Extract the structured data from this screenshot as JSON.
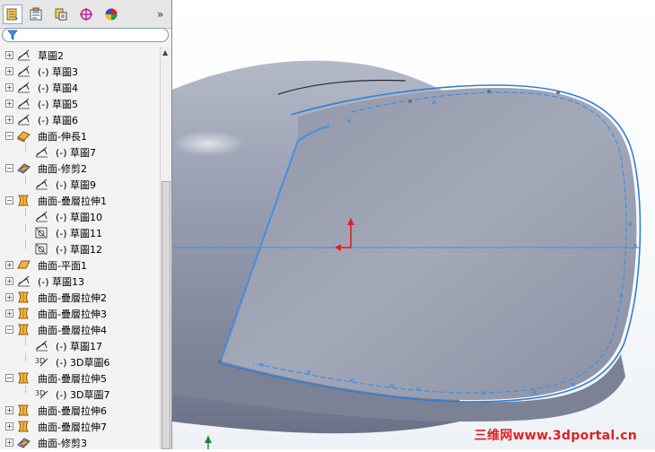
{
  "tabs": [
    {
      "name": "feature-manager",
      "icon": "feature-tree-icon",
      "active": true
    },
    {
      "name": "property-manager",
      "icon": "property-manager-icon",
      "active": false
    },
    {
      "name": "configuration-manager",
      "icon": "configuration-manager-icon",
      "active": false
    },
    {
      "name": "dimxpert-manager",
      "icon": "dimxpert-icon",
      "active": false
    },
    {
      "name": "display-manager",
      "icon": "display-manager-icon",
      "active": false
    }
  ],
  "more_glyph": "»",
  "filter": {
    "placeholder": "",
    "value": ""
  },
  "tree": [
    {
      "label": "草圖2",
      "icon": "sketch-icon",
      "indent": 0
    },
    {
      "label": "(-) 草圖3",
      "icon": "sketch-icon",
      "indent": 0
    },
    {
      "label": "(-) 草圖4",
      "icon": "sketch-icon",
      "indent": 0
    },
    {
      "label": "(-) 草圖5",
      "icon": "sketch-icon",
      "indent": 0
    },
    {
      "label": "(-) 草圖6",
      "icon": "sketch-icon",
      "indent": 0
    },
    {
      "label": "曲面-伸長1",
      "icon": "surface-extrude-icon",
      "indent": 0,
      "expanded": true
    },
    {
      "label": "(-) 草圖7",
      "icon": "sketch-icon",
      "indent": 1
    },
    {
      "label": "曲面-修剪2",
      "icon": "surface-trim-icon",
      "indent": 0,
      "expanded": true
    },
    {
      "label": "(-) 草圖9",
      "icon": "sketch-icon",
      "indent": 1
    },
    {
      "label": "曲面-疊層拉伸1",
      "icon": "surface-loft-icon",
      "indent": 0,
      "expanded": true
    },
    {
      "label": "(-) 草圖10",
      "icon": "sketch-icon",
      "indent": 1
    },
    {
      "label": "(-) 草圖11",
      "icon": "sketch-plane-icon",
      "indent": 1
    },
    {
      "label": "(-) 草圖12",
      "icon": "sketch-plane-icon",
      "indent": 1
    },
    {
      "label": "曲面-平面1",
      "icon": "surface-planar-icon",
      "indent": 0
    },
    {
      "label": "(-) 草圖13",
      "icon": "sketch-icon",
      "indent": 0
    },
    {
      "label": "曲面-疊層拉伸2",
      "icon": "surface-loft-icon",
      "indent": 0
    },
    {
      "label": "曲面-疊層拉伸3",
      "icon": "surface-loft-icon",
      "indent": 0
    },
    {
      "label": "曲面-疊層拉伸4",
      "icon": "surface-loft-icon",
      "indent": 0,
      "expanded": true
    },
    {
      "label": "(-) 草圖17",
      "icon": "sketch-icon",
      "indent": 1
    },
    {
      "label": "(-) 3D草圖6",
      "icon": "3d-sketch-icon",
      "indent": 1
    },
    {
      "label": "曲面-疊層拉伸5",
      "icon": "surface-loft-icon",
      "indent": 0,
      "expanded": true
    },
    {
      "label": "(-) 3D草圖7",
      "icon": "3d-sketch-icon",
      "indent": 1
    },
    {
      "label": "曲面-疊層拉伸6",
      "icon": "surface-loft-icon",
      "indent": 0
    },
    {
      "label": "曲面-疊層拉伸7",
      "icon": "surface-loft-icon",
      "indent": 0
    },
    {
      "label": "曲面-修剪3",
      "icon": "surface-trim-icon",
      "indent": 0
    }
  ],
  "watermark": "三维网www.3dportal.cn",
  "colors": {
    "model_surface": "#8e94a6",
    "model_highlight": "#c7cbd8",
    "edge_blue": "#2f7fd6",
    "selection_blue": "#3d8fe6",
    "origin_red": "#e02020",
    "watermark_red": "#e02020"
  }
}
